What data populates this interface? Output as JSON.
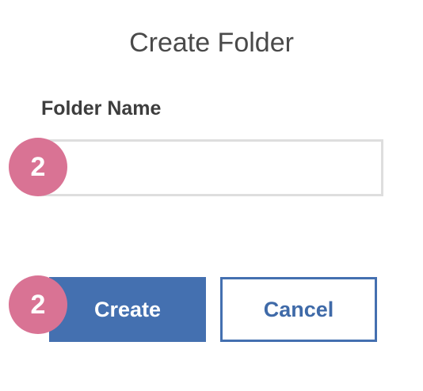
{
  "dialog": {
    "title": "Create Folder",
    "field_label": "Folder Name",
    "field_value": "",
    "field_placeholder": "",
    "create_label": "Create",
    "cancel_label": "Cancel"
  },
  "badges": {
    "field_badge": "2",
    "create_badge": "2"
  },
  "colors": {
    "primary": "#4470b0",
    "badge": "#d97394",
    "input_border": "#dedede"
  }
}
